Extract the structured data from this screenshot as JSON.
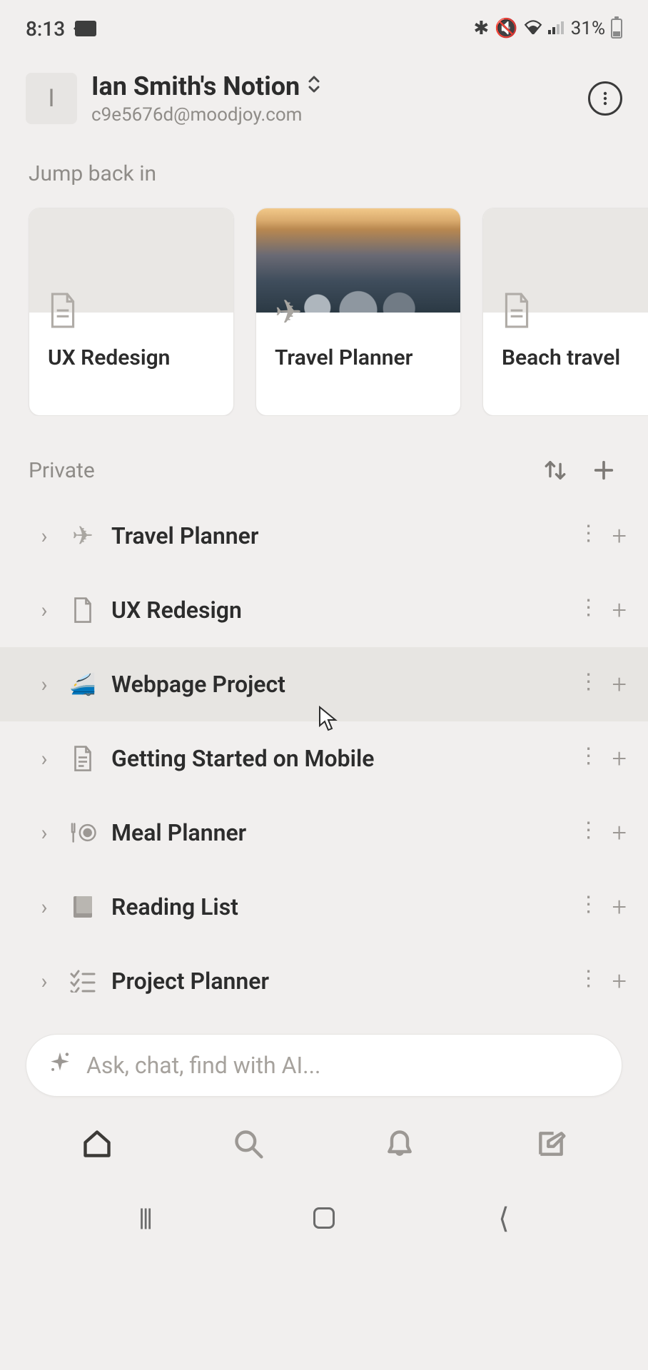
{
  "status": {
    "time": "8:13",
    "battery": "31%"
  },
  "workspace": {
    "avatar_initial": "I",
    "title": "Ian Smith's Notion",
    "email": "c9e5676d@moodjoy.com"
  },
  "jump_back": {
    "label": "Jump back in",
    "cards": [
      {
        "title": "UX Redesign",
        "icon": "doc"
      },
      {
        "title": "Travel Planner",
        "icon": "plane",
        "cover": "sky"
      },
      {
        "title": "Beach travel",
        "icon": "doc"
      }
    ]
  },
  "section": {
    "title": "Private"
  },
  "pages": [
    {
      "title": "Travel Planner",
      "icon": "✈",
      "highlight": false
    },
    {
      "title": "UX Redesign",
      "icon": "doc",
      "highlight": false
    },
    {
      "title": "Webpage Project",
      "icon": "🚄",
      "highlight": true
    },
    {
      "title": "Getting Started on Mobile",
      "icon": "doc-lines",
      "highlight": false
    },
    {
      "title": "Meal Planner",
      "icon": "🍴◎",
      "highlight": false
    },
    {
      "title": "Reading List",
      "icon": "📕",
      "highlight": false
    },
    {
      "title": "Project Planner",
      "icon": "checklist",
      "highlight": false
    }
  ],
  "ai": {
    "placeholder": "Ask, chat, find with AI..."
  }
}
